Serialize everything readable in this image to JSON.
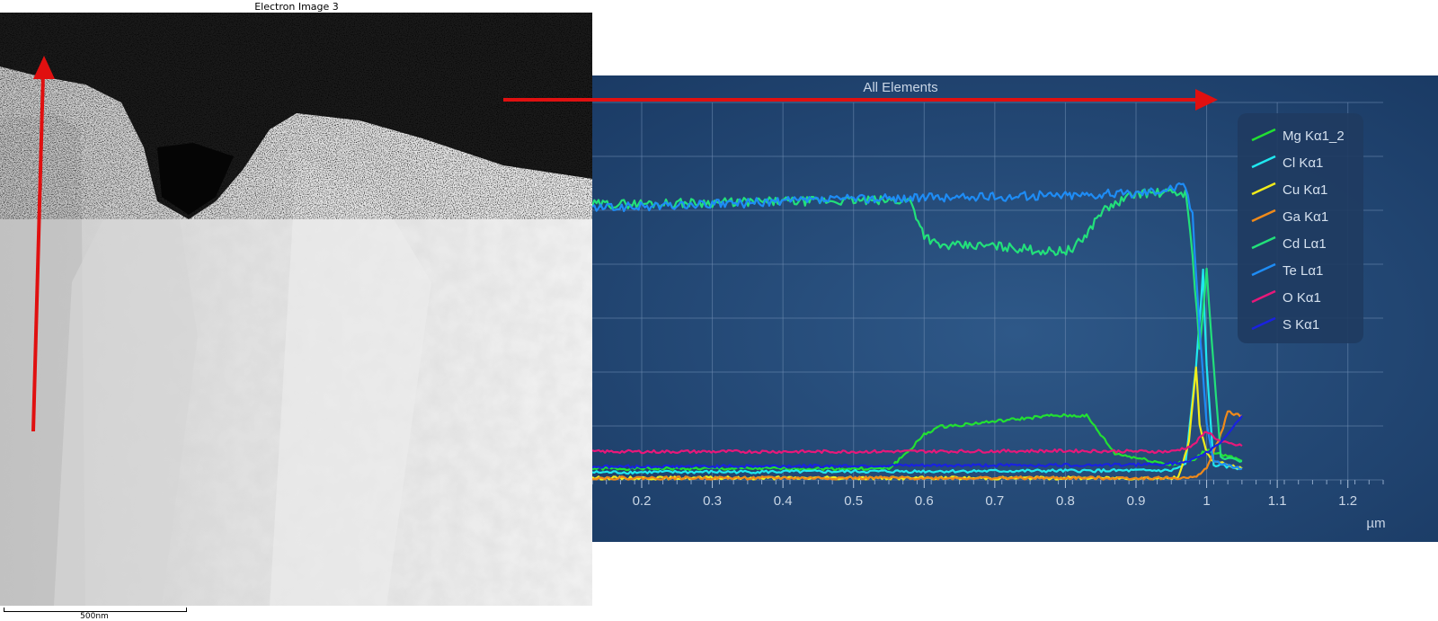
{
  "electron_image": {
    "title": "Electron Image 3",
    "scale_bar_label": "500nm",
    "icon": "sem-micrograph"
  },
  "chart_data": {
    "type": "line",
    "title": "All Elements",
    "xlabel": "µm",
    "ylabel": "",
    "xlim": [
      0.13,
      1.25
    ],
    "ylim": [
      0,
      1
    ],
    "x_ticks": [
      "0.2",
      "0.3",
      "0.4",
      "0.5",
      "0.6",
      "0.7",
      "0.8",
      "0.9",
      "1",
      "1.1",
      "1.2"
    ],
    "grid": true,
    "legend_position": "top-right",
    "series": [
      {
        "name": "Mg Kα1_2",
        "color": "#22e032",
        "points": [
          [
            0.13,
            0.03
          ],
          [
            0.55,
            0.03
          ],
          [
            0.58,
            0.08
          ],
          [
            0.6,
            0.12
          ],
          [
            0.62,
            0.14
          ],
          [
            0.7,
            0.155
          ],
          [
            0.78,
            0.17
          ],
          [
            0.83,
            0.17
          ],
          [
            0.85,
            0.12
          ],
          [
            0.87,
            0.07
          ],
          [
            0.95,
            0.04
          ],
          [
            0.98,
            0.05
          ],
          [
            1.0,
            0.08
          ],
          [
            1.05,
            0.05
          ]
        ]
      },
      {
        "name": "Cl Kα1",
        "color": "#20e8f0",
        "points": [
          [
            0.13,
            0.02
          ],
          [
            0.95,
            0.025
          ],
          [
            0.97,
            0.04
          ],
          [
            0.985,
            0.3
          ],
          [
            0.995,
            0.55
          ],
          [
            1.0,
            0.3
          ],
          [
            1.01,
            0.04
          ],
          [
            1.05,
            0.03
          ]
        ]
      },
      {
        "name": "Cu Kα1",
        "color": "#f2ec1a",
        "points": [
          [
            0.13,
            0.005
          ],
          [
            0.96,
            0.005
          ],
          [
            0.975,
            0.1
          ],
          [
            0.985,
            0.3
          ],
          [
            0.99,
            0.15
          ],
          [
            1.0,
            0.07
          ],
          [
            1.01,
            0.05
          ],
          [
            1.05,
            0.03
          ]
        ]
      },
      {
        "name": "Ga Kα1",
        "color": "#f08a1a",
        "points": [
          [
            0.13,
            0.005
          ],
          [
            0.98,
            0.005
          ],
          [
            1.0,
            0.03
          ],
          [
            1.02,
            0.12
          ],
          [
            1.03,
            0.18
          ],
          [
            1.05,
            0.17
          ]
        ]
      },
      {
        "name": "Cd Lα1",
        "color": "#22e07a",
        "points": [
          [
            0.13,
            0.73
          ],
          [
            0.3,
            0.735
          ],
          [
            0.5,
            0.74
          ],
          [
            0.58,
            0.74
          ],
          [
            0.6,
            0.65
          ],
          [
            0.62,
            0.62
          ],
          [
            0.7,
            0.62
          ],
          [
            0.78,
            0.605
          ],
          [
            0.81,
            0.61
          ],
          [
            0.83,
            0.65
          ],
          [
            0.85,
            0.71
          ],
          [
            0.9,
            0.76
          ],
          [
            0.97,
            0.76
          ],
          [
            0.98,
            0.6
          ],
          [
            0.99,
            0.35
          ],
          [
            1.0,
            0.55
          ],
          [
            1.01,
            0.3
          ],
          [
            1.02,
            0.06
          ],
          [
            1.05,
            0.05
          ]
        ]
      },
      {
        "name": "Te Lα1",
        "color": "#1e8cf5",
        "points": [
          [
            0.13,
            0.72
          ],
          [
            0.3,
            0.73
          ],
          [
            0.5,
            0.745
          ],
          [
            0.7,
            0.75
          ],
          [
            0.8,
            0.755
          ],
          [
            0.9,
            0.76
          ],
          [
            0.97,
            0.78
          ],
          [
            0.98,
            0.7
          ],
          [
            0.99,
            0.4
          ],
          [
            1.0,
            0.15
          ],
          [
            1.01,
            0.05
          ],
          [
            1.05,
            0.03
          ]
        ]
      },
      {
        "name": "O Kα1",
        "color": "#e8187a",
        "points": [
          [
            0.13,
            0.075
          ],
          [
            0.5,
            0.075
          ],
          [
            0.8,
            0.077
          ],
          [
            0.95,
            0.075
          ],
          [
            0.98,
            0.09
          ],
          [
            1.0,
            0.13
          ],
          [
            1.02,
            0.1
          ],
          [
            1.05,
            0.09
          ]
        ]
      },
      {
        "name": "S Kα1",
        "color": "#1a22e0",
        "points": [
          [
            0.13,
            0.035
          ],
          [
            0.9,
            0.04
          ],
          [
            0.97,
            0.045
          ],
          [
            0.99,
            0.06
          ],
          [
            1.02,
            0.1
          ],
          [
            1.05,
            0.17
          ]
        ]
      }
    ]
  }
}
